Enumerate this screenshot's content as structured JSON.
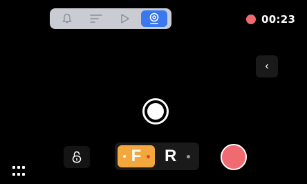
{
  "mode_bar": {
    "items": [
      {
        "icon": "bell-icon",
        "active": false
      },
      {
        "icon": "filter-lines-icon",
        "active": false
      },
      {
        "icon": "play-outline-icon",
        "active": false
      },
      {
        "icon": "webcam-icon",
        "active": true
      }
    ],
    "active_color": "#3b78f0"
  },
  "recording": {
    "indicator_color": "#f06a72",
    "time": "00:23"
  },
  "side_toggle": {
    "icon": "chevron-left-icon",
    "glyph": "‹"
  },
  "capture": {
    "icon": "circle-capture-icon"
  },
  "lock": {
    "icon": "unlock-icon"
  },
  "gear_selector": {
    "forward_label": "F",
    "reverse_label": "R",
    "selected": "F",
    "selected_color": "#f3a73c"
  },
  "record_button": {
    "color": "#f06a72"
  },
  "apps": {
    "icon": "grid-dots-icon"
  }
}
